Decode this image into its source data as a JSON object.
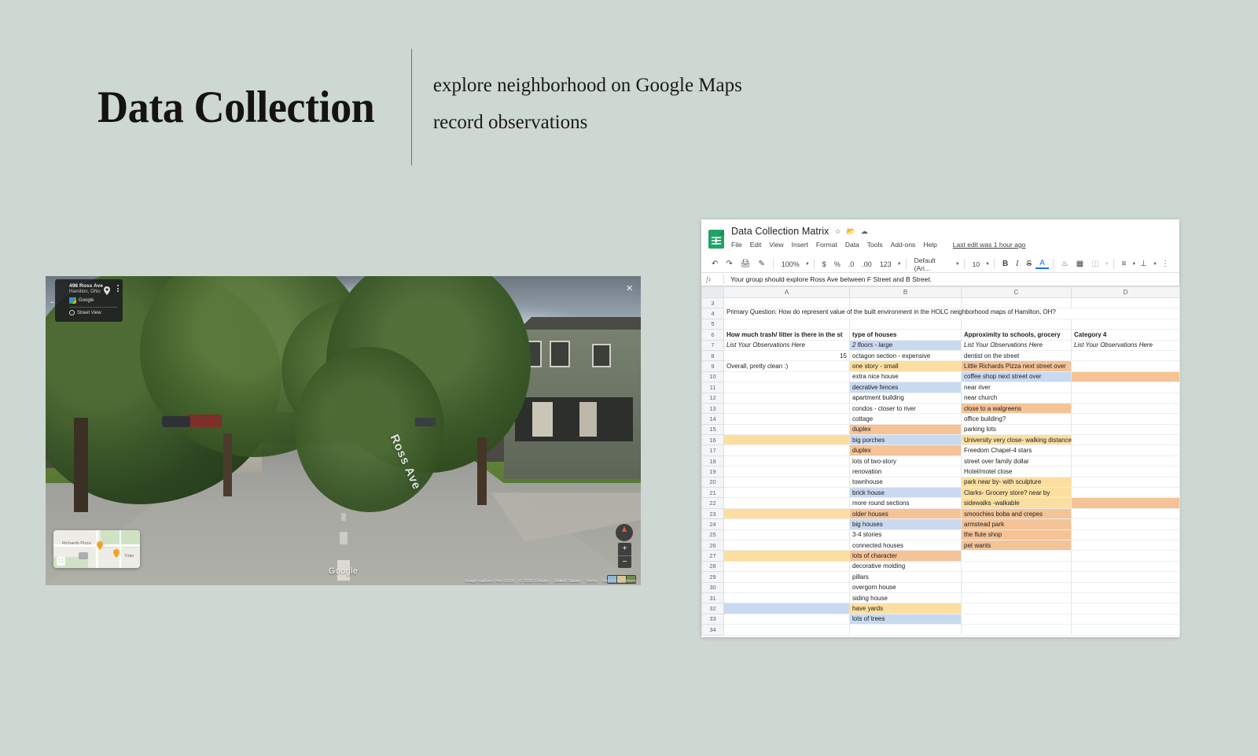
{
  "slide": {
    "title": "Data Collection",
    "subtitle_lines": [
      "explore neighborhood on Google Maps",
      "record observations"
    ],
    "background_color": "#ced8d3"
  },
  "streetview": {
    "address": "498 Ross Ave",
    "city": "Hamilton, Ohio",
    "provider_label": "Google",
    "mode_label": "Street View",
    "watermark": "Google",
    "close_label": "×",
    "back_icon": "arrow-left-icon",
    "pin_icon": "map-pin-icon",
    "menu_icon": "kebab-menu-icon",
    "clock_icon": "clock-icon",
    "street_sign": "Ross Ave",
    "minimap": {
      "labels": [
        "Richards Pizza",
        "Trian"
      ],
      "expand_icon": "expand-icon"
    },
    "zoom_in": "+",
    "zoom_out": "−",
    "attribution": [
      "Image capture: Nov 2018",
      "© 2020 Google",
      "United States",
      "Terms",
      "Report a problem"
    ]
  },
  "sheets": {
    "doc_title": "Data Collection Matrix",
    "title_icons": [
      "star-icon",
      "move-to-folder-icon",
      "cloud-status-icon"
    ],
    "menu": [
      "File",
      "Edit",
      "View",
      "Insert",
      "Format",
      "Data",
      "Tools",
      "Add-ons",
      "Help"
    ],
    "last_edit": "Last edit was 1 hour ago",
    "toolbar": {
      "undo_icon": "undo-icon",
      "redo_icon": "redo-icon",
      "print_icon": "print-icon",
      "paint_format_icon": "paint-format-icon",
      "zoom": "100%",
      "currency_icon": "$",
      "percent_icon": "%",
      "decrease_decimal_icon": ".0",
      "increase_decimal_icon": ".00",
      "more_formats": "123",
      "font": "Default (Ari...",
      "font_size": "10",
      "bold": "B",
      "italic": "I",
      "strikethrough": "S",
      "text_color": "A",
      "fill_color_icon": "fill-color-icon",
      "borders_icon": "borders-icon",
      "merge_cells_icon": "merge-cells-icon",
      "halign_icon": "horizontal-align-icon",
      "valign_icon": "vertical-align-icon",
      "more_icon": "more-options-icon"
    },
    "formula_bar": {
      "fx_label": "fx",
      "value": "Your group should explore Ross Ave between F Street and B Street."
    },
    "columns": [
      "A",
      "B",
      "C",
      "D"
    ],
    "rows": [
      {
        "n": "3",
        "a": "",
        "b": "",
        "c": "",
        "d": ""
      },
      {
        "n": "4",
        "a": "Primary Question: How do represent value of the built environment in the HOLC neighborhood maps of Hamilton, OH?",
        "b": "",
        "c": "",
        "d": "",
        "a_span": true
      },
      {
        "n": "5",
        "a": "",
        "b": "",
        "c": "",
        "d": ""
      },
      {
        "n": "6",
        "a": "How much trash/ litter is there in the st",
        "b": "type of houses",
        "c": "Approximity to schools, grocery",
        "d": "Category 4",
        "bold": true
      },
      {
        "n": "7",
        "a": "List Your Observations Here",
        "b": "2 floors - large",
        "c": "List Your Observations Here",
        "d": "List Your Observations Here",
        "italic": true,
        "b_fill": "#c9daf0"
      },
      {
        "n": "8",
        "a": "15",
        "a_num": true,
        "b": "octagon section - expensive",
        "c": "dentist on the street",
        "d": ""
      },
      {
        "n": "9",
        "a": "Overall, pretty clean :)",
        "b": "one story - small",
        "c": "Little Richards Pizza next street over",
        "b_fill": "#fcdfa0",
        "c_fill": "#f5c396",
        "d": ""
      },
      {
        "n": "10",
        "a": "",
        "b": "extra nice house",
        "c": "coffee shop next street over",
        "c_fill": "#c9daf0",
        "d": "",
        "d_fill": "#f5c396"
      },
      {
        "n": "11",
        "a": "",
        "b": "decrative fences",
        "b_fill": "#c9daf0",
        "c": "near river",
        "d": ""
      },
      {
        "n": "12",
        "a": "",
        "b": "apartment building",
        "c": "near church",
        "d": ""
      },
      {
        "n": "13",
        "a": "",
        "b": "condos - closer to river",
        "c": "close to a walgreens",
        "c_fill": "#f5c396",
        "d": ""
      },
      {
        "n": "14",
        "a": "",
        "b": "cottage",
        "c": "office building?",
        "d": ""
      },
      {
        "n": "15",
        "a": "",
        "b": "duplex",
        "b_fill": "#f5c396",
        "c": "parking lots",
        "d": ""
      },
      {
        "n": "16",
        "a": "",
        "a_fill": "#fcdfa0",
        "b": "big porches",
        "b_fill": "#c9daf0",
        "c": "University very close- walking distance",
        "c_fill": "#fcdfa0",
        "d": ""
      },
      {
        "n": "17",
        "a": "",
        "b": "duplex",
        "b_fill": "#f5c396",
        "c": "Freedom Chapel-4 stars",
        "d": ""
      },
      {
        "n": "18",
        "a": "",
        "b": "lots of two-story",
        "c": "street over family dollar",
        "d": ""
      },
      {
        "n": "19",
        "a": "",
        "b": "renovation",
        "c": "Hotel/motel close",
        "d": ""
      },
      {
        "n": "20",
        "a": "",
        "b": "townhouse",
        "c": "park near by- with sculpture",
        "c_fill": "#fcdfa0",
        "d": ""
      },
      {
        "n": "21",
        "a": "",
        "b": "brick house",
        "b_fill": "#c9daf0",
        "c": "Clarks- Grocery store? near by",
        "c_fill": "#fcdfa0",
        "d": ""
      },
      {
        "n": "22",
        "a": "",
        "b": "more round sections",
        "c": "sidewalks -walkable",
        "c_fill": "#fcdfa0",
        "d": "",
        "d_fill": "#f5c396"
      },
      {
        "n": "23",
        "a": "",
        "a_fill": "#fcdfa0",
        "b": "older houses",
        "b_fill": "#f5c396",
        "c": "smoochies boba and crepes",
        "c_fill": "#f5c396",
        "d": ""
      },
      {
        "n": "24",
        "a": "",
        "b": "big houses",
        "b_fill": "#c9daf0",
        "c": "armstead park",
        "c_fill": "#f5c396",
        "d": ""
      },
      {
        "n": "25",
        "a": "",
        "b": "3-4 stories",
        "c": "the flute shop",
        "c_fill": "#f5c396",
        "d": ""
      },
      {
        "n": "26",
        "a": "",
        "b": "connected houses",
        "c": "pet wants",
        "c_fill": "#f5c396",
        "d": ""
      },
      {
        "n": "27",
        "a": "",
        "a_fill": "#fcdfa0",
        "b": "lots of character",
        "b_fill": "#f5c396",
        "c": "",
        "d": ""
      },
      {
        "n": "28",
        "a": "",
        "b": "decorative molding",
        "c": "",
        "d": ""
      },
      {
        "n": "29",
        "a": "",
        "b": "pillars",
        "c": "",
        "d": ""
      },
      {
        "n": "30",
        "a": "",
        "b": "overgorn house",
        "c": "",
        "d": ""
      },
      {
        "n": "31",
        "a": "",
        "b": "siding house",
        "c": "",
        "d": ""
      },
      {
        "n": "32",
        "a": "",
        "a_fill": "#c9daf0",
        "b": "have yards",
        "b_fill": "#fcdfa0",
        "c": "",
        "d": ""
      },
      {
        "n": "33",
        "a": "",
        "b": "lots of trees",
        "b_fill": "#c9daf0",
        "c": "",
        "d": ""
      },
      {
        "n": "34",
        "a": "",
        "b": "",
        "c": "",
        "d": ""
      }
    ]
  }
}
